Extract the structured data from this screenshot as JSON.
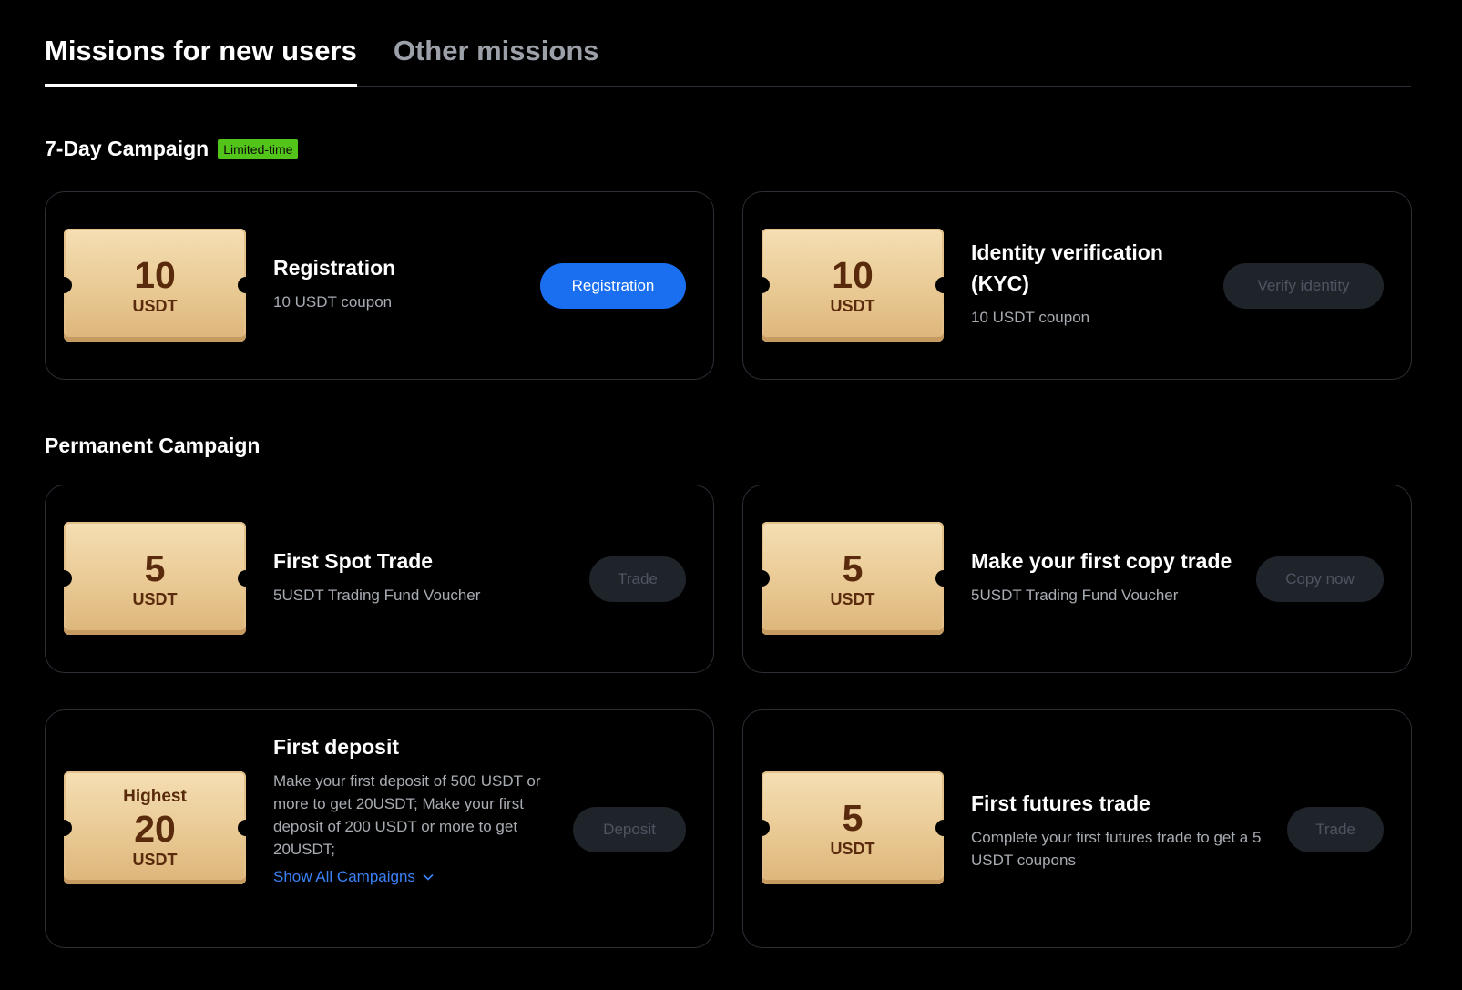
{
  "tabs": [
    {
      "label": "Missions for new users",
      "active": true
    },
    {
      "label": "Other missions",
      "active": false
    }
  ],
  "campaign7": {
    "title": "7-Day Campaign",
    "badge": "Limited-time",
    "badge_color": "#53c41a"
  },
  "permanent": {
    "title": "Permanent Campaign"
  },
  "missions": [
    {
      "ticket_value": "10",
      "ticket_unit": "USDT",
      "title": "Registration",
      "desc": "10 USDT coupon",
      "button": "Registration",
      "button_state": "primary"
    },
    {
      "ticket_value": "10",
      "ticket_unit": "USDT",
      "title": "Identity verification (KYC)",
      "desc": "10 USDT coupon",
      "button": "Verify identity",
      "button_state": "disabled"
    },
    {
      "ticket_value": "5",
      "ticket_unit": "USDT",
      "title": "First Spot Trade",
      "desc": "5USDT Trading Fund Voucher",
      "button": "Trade",
      "button_state": "disabled"
    },
    {
      "ticket_value": "5",
      "ticket_unit": "USDT",
      "title": "Make your first copy trade",
      "desc": "5USDT Trading Fund Voucher",
      "button": "Copy now",
      "button_state": "disabled"
    },
    {
      "ticket_prefix": "Highest",
      "ticket_value": "20",
      "ticket_unit": "USDT",
      "title": "First deposit",
      "desc": "Make your first deposit of 500 USDT or more to get 20USDT;   Make your first deposit of 200 USDT or more to get 20USDT;",
      "link": "Show All Campaigns",
      "button": "Deposit",
      "button_state": "disabled"
    },
    {
      "ticket_value": "5",
      "ticket_unit": "USDT",
      "title": "First futures trade",
      "desc": "Complete your first futures trade to get a 5 USDT coupons",
      "button": "Trade",
      "button_state": "disabled"
    }
  ],
  "colors": {
    "background": "#000000",
    "primary_button": "#1a6ff0",
    "disabled_button": "#1f242b",
    "link": "#3b82f6",
    "ticket_gold": "#e9c993"
  }
}
